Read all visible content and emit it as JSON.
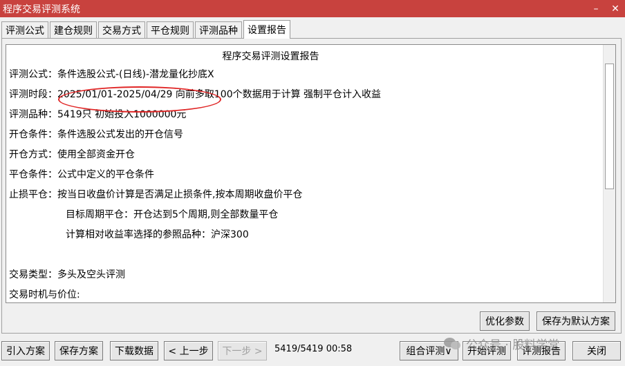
{
  "window": {
    "title": "程序交易评测系统",
    "minimize_symbol": "–",
    "close_symbol": "✕"
  },
  "tabs": [
    {
      "label": "评测公式"
    },
    {
      "label": "建仓规则"
    },
    {
      "label": "交易方式"
    },
    {
      "label": "平仓规则"
    },
    {
      "label": "评测品种"
    },
    {
      "label": "设置报告"
    }
  ],
  "active_tab": "设置报告",
  "report": {
    "heading": "程序交易评测设置报告",
    "formula": "评测公式：条件选股公式-(日线)-潜龙量化抄底X",
    "period": "评测时段：2025/01/01-2025/04/29 向前多取100个数据用于计算 强制平仓计入收益",
    "varieties": "评测品种：5419只 初始投入1000000元",
    "open_condition": "开仓条件：条件选股公式发出的开仓信号",
    "open_method": "开仓方式：使用全部资金开仓",
    "close_condition": "平仓条件：公式中定义的平仓条件",
    "stop_loss": "止损平仓：按当日收盘价计算是否满足止损条件,按本周期收盘价平仓",
    "target_period": "目标周期平仓：开仓达到5个周期,则全部数量平仓",
    "benchmark": "计算相对收益率选择的参照品种：沪深300",
    "trade_type": "交易类型：多头及空头评测",
    "trade_timing": "交易时机与价位:"
  },
  "panel_buttons": {
    "optimize": "优化参数",
    "save_default": "保存为默认方案"
  },
  "bottom_buttons": {
    "import": "引入方案",
    "save": "保存方案",
    "download": "下载数据",
    "prev": "< 上一步",
    "next": "下一步 >",
    "combo": "组合评测∨",
    "start": "开始评测",
    "report": "评测报告",
    "close": "关闭"
  },
  "status": {
    "progress": "5419/5419",
    "time": "00:58"
  },
  "watermark": {
    "text": "公众号 · 股料学堂"
  },
  "colors": {
    "titlebar": "#c8423e",
    "annotation": "#e02525"
  }
}
